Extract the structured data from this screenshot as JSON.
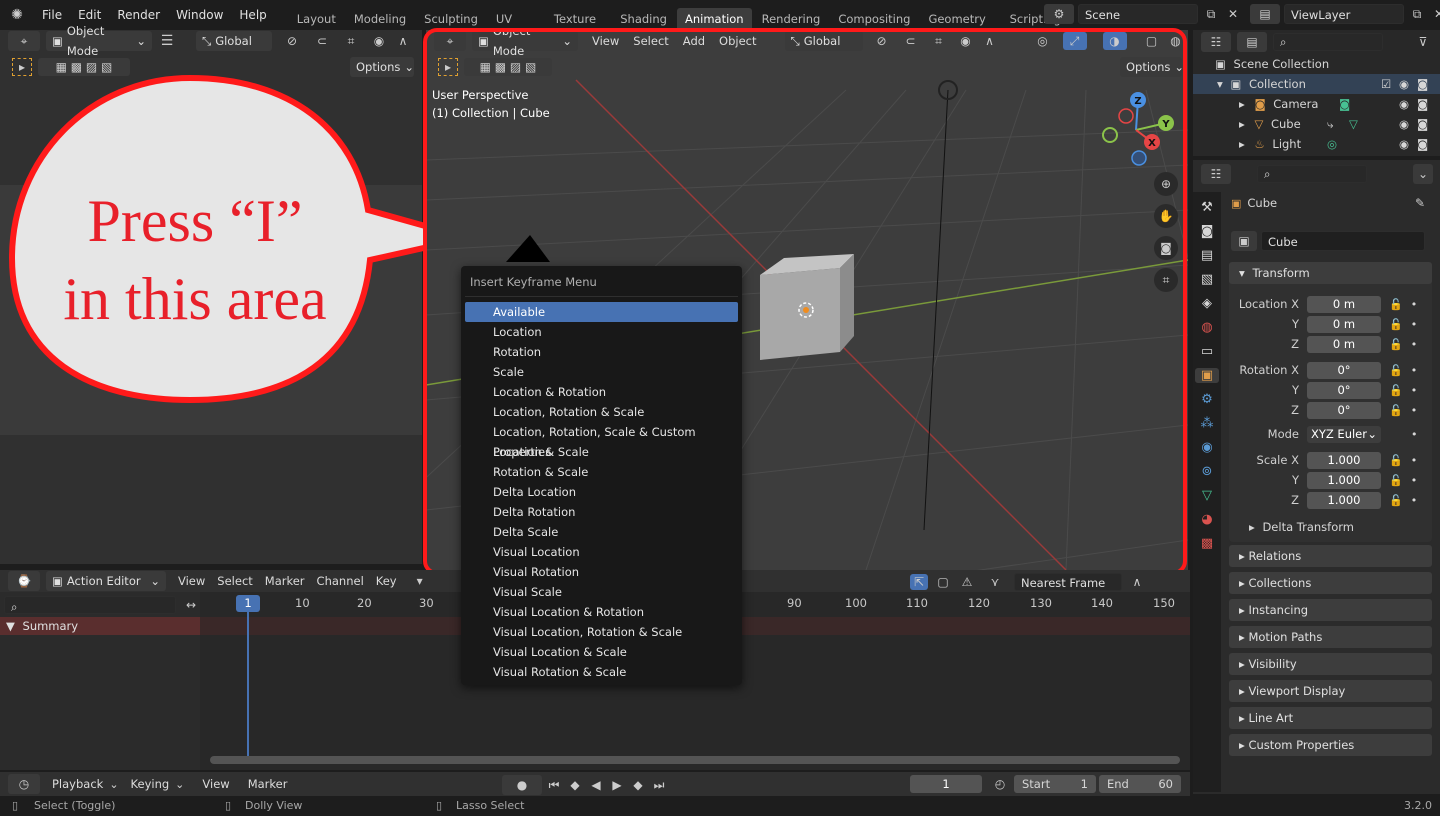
{
  "topbar": {
    "menus": [
      "File",
      "Edit",
      "Render",
      "Window",
      "Help"
    ],
    "workspaces": [
      "Layout",
      "Modeling",
      "Sculpting",
      "UV Editing",
      "Texture Paint",
      "Shading",
      "Animation",
      "Rendering",
      "Compositing",
      "Geometry Nodes",
      "Scripting"
    ],
    "active_workspace": "Animation",
    "scene_name": "Scene",
    "view_layer": "ViewLayer"
  },
  "left_area": {
    "mode": "Object Mode",
    "orientation": "Global",
    "options_label": "Options"
  },
  "callout": {
    "line1": "Press “I”",
    "line2": "in this area"
  },
  "viewport": {
    "mode": "Object Mode",
    "menus": [
      "View",
      "Select",
      "Add",
      "Object"
    ],
    "orientation": "Global",
    "options_label": "Options",
    "perspective_label": "User Perspective",
    "collection_label": "(1) Collection | Cube",
    "gizmo_axes": [
      "Z",
      "Y",
      "X"
    ]
  },
  "keyframe_menu": {
    "title": "Insert Keyframe Menu",
    "items": [
      "Available",
      "Location",
      "Rotation",
      "Scale",
      "Location & Rotation",
      "Location, Rotation & Scale",
      "Location, Rotation, Scale & Custom Properties",
      "Location & Scale",
      "Rotation & Scale",
      "Delta Location",
      "Delta Rotation",
      "Delta Scale",
      "Visual Location",
      "Visual Rotation",
      "Visual Scale",
      "Visual Location & Rotation",
      "Visual Location, Rotation & Scale",
      "Visual Location & Scale",
      "Visual Rotation & Scale"
    ],
    "active_index": 0
  },
  "action_editor": {
    "editor_type": "Action Editor",
    "menus": [
      "View",
      "Select",
      "Marker",
      "Channel",
      "Key"
    ],
    "snap_mode": "Nearest Frame",
    "summary_label": "Summary",
    "current_frame_badge": "1",
    "ticks": [
      "10",
      "20",
      "30",
      "90",
      "100",
      "110",
      "120",
      "130",
      "140",
      "150"
    ]
  },
  "timeline": {
    "menus": [
      "Playback",
      "Keying",
      "View",
      "Marker"
    ],
    "current_frame": "1",
    "start_label": "Start",
    "start_value": "1",
    "end_label": "End",
    "end_value": "60"
  },
  "statusbar": {
    "select_hint": "Select (Toggle)",
    "dolly_hint": "Dolly View",
    "lasso_hint": "Lasso Select",
    "version": "3.2.0"
  },
  "outliner": {
    "scene_collection": "Scene Collection",
    "collection": "Collection",
    "items": [
      "Camera",
      "Cube",
      "Light"
    ]
  },
  "properties": {
    "object_name": "Cube",
    "data_name": "Cube",
    "transform_label": "Transform",
    "location_label": "Location X",
    "rotation_label": "Rotation X",
    "scale_label": "Scale X",
    "axis_y": "Y",
    "axis_z": "Z",
    "location": [
      "0 m",
      "0 m",
      "0 m"
    ],
    "rotation": [
      "0°",
      "0°",
      "0°"
    ],
    "mode_label": "Mode",
    "rotation_mode": "XYZ Euler",
    "scale": [
      "1.000",
      "1.000",
      "1.000"
    ],
    "delta_transform": "Delta Transform",
    "panels": [
      "Relations",
      "Collections",
      "Instancing",
      "Motion Paths",
      "Visibility",
      "Viewport Display",
      "Line Art",
      "Custom Properties"
    ]
  },
  "colors": {
    "accent_blue": "#4772b3",
    "highlight_red": "#ff1a1a",
    "x_axis": "#e64545",
    "y_axis": "#8bc34a",
    "z_axis": "#4a90e2"
  }
}
